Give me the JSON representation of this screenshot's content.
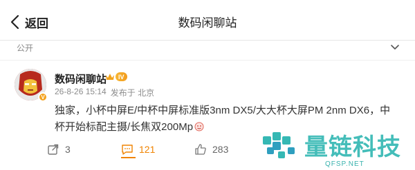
{
  "header": {
    "back_label": "返回",
    "title": "数码闲聊站"
  },
  "visibility": {
    "label": "公开"
  },
  "post": {
    "author": "数码闲聊站",
    "level": "IV",
    "timestamp": "26-8-26 15:14",
    "source": "发布于 北京",
    "body": "独家，小杯中屏E/中杯中屏标准版3nm DX5/大大杯大屏PM 2nm DX6，中杯开始标配主摄/长焦双200Mp",
    "avatar_badge": "V"
  },
  "actions": {
    "reposts": "3",
    "comments": "121",
    "likes": "283"
  },
  "watermark": {
    "brand": "量链科技",
    "domain": "QFSP.NET"
  },
  "colors": {
    "accent_orange": "#f08300",
    "watermark_teal": "#35b8b4",
    "avatar_red": "#b72a1d"
  }
}
